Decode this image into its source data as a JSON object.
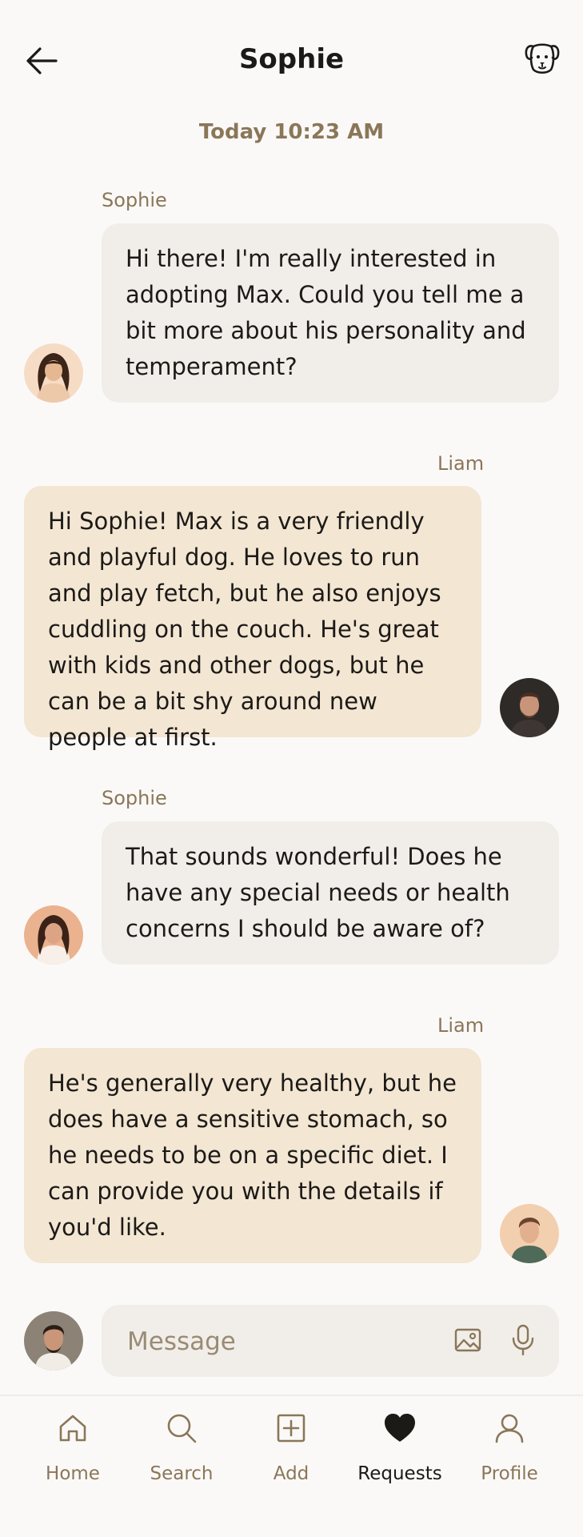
{
  "header": {
    "title": "Sophie",
    "back_icon": "arrow-left-icon",
    "action_icon": "dog-icon"
  },
  "timestamp": "Today 10:23 AM",
  "messages": [
    {
      "sender": "Sophie",
      "direction": "incoming",
      "text": "Hi there! I'm really interested in adopting Max. Could you tell me a bit more about his personality and temperament?"
    },
    {
      "sender": "Liam",
      "direction": "outgoing",
      "text": "Hi Sophie! Max is a very friendly and playful dog. He loves to run and play fetch, but he also enjoys cuddling on the couch. He's great with kids and other dogs, but he can be a bit shy around new people at first."
    },
    {
      "sender": "Sophie",
      "direction": "incoming",
      "text": "That sounds wonderful! Does he have any special needs or health concerns I should be aware of?"
    },
    {
      "sender": "Liam",
      "direction": "outgoing",
      "text": "He's generally very healthy, but he does have a sensitive stomach, so he needs to be on a specific diet. I can provide you with the details if you'd like."
    }
  ],
  "composer": {
    "placeholder": "Message",
    "image_icon": "image-icon",
    "mic_icon": "microphone-icon"
  },
  "nav": {
    "items": [
      {
        "label": "Home",
        "icon": "home-icon"
      },
      {
        "label": "Search",
        "icon": "search-icon"
      },
      {
        "label": "Add",
        "icon": "add-square-icon"
      },
      {
        "label": "Requests",
        "icon": "heart-icon",
        "active": true
      },
      {
        "label": "Profile",
        "icon": "profile-icon"
      }
    ]
  },
  "colors": {
    "background": "#fbf9f8",
    "incoming_bubble": "#f1eeea",
    "outgoing_bubble": "#f3e6d3",
    "accent_text": "#8a7758"
  }
}
